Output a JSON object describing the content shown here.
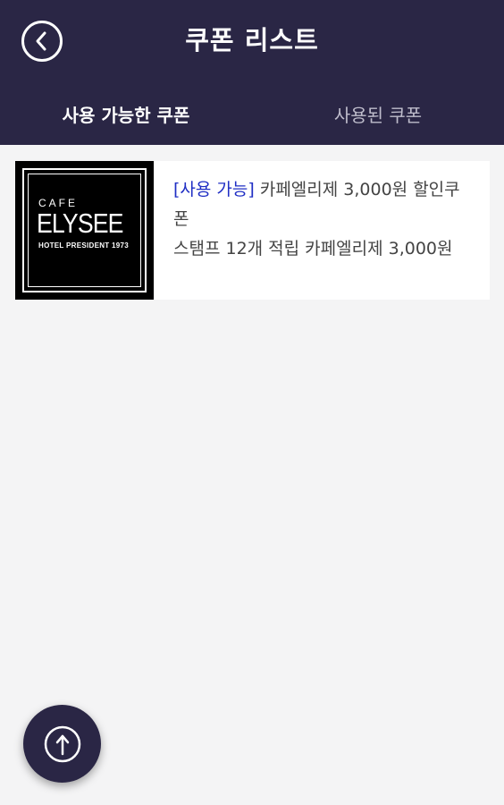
{
  "header": {
    "title": "쿠폰 리스트",
    "back_icon": "chevron-left-icon"
  },
  "tabs": [
    {
      "label": "사용 가능한 쿠폰",
      "active": true
    },
    {
      "label": "사용된 쿠폰",
      "active": false
    }
  ],
  "coupons": [
    {
      "logo": {
        "top": "CAFE",
        "main": "ELYSEE",
        "sub": "HOTEL PRESIDENT 1973"
      },
      "status": "[사용 가능]",
      "title": " 카페엘리제 3,000원 할인쿠폰",
      "description": "스탬프 12개 적립 카페엘리제 3,000원"
    }
  ],
  "fab": {
    "icon": "scroll-to-top-arrow-icon"
  },
  "colors": {
    "header_bg": "#2a2645",
    "page_bg": "#f4f4f5",
    "status_text": "#1f2ec4",
    "inactive_tab": "#bfbdcc"
  }
}
